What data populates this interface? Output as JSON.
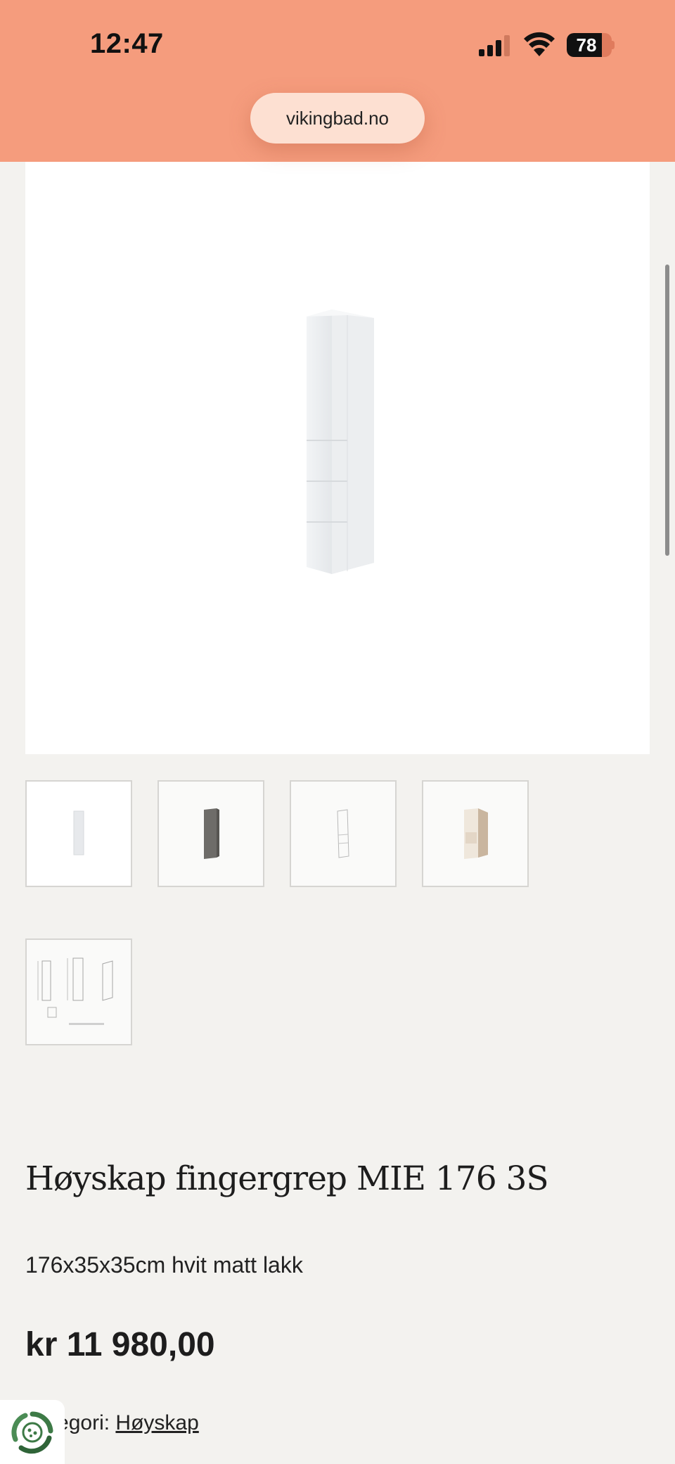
{
  "status_bar": {
    "time": "12:47",
    "battery_percent": "78",
    "battery_level": 0.78,
    "background_color": "#f59c7d"
  },
  "browser": {
    "url": "vikingbad.no"
  },
  "product": {
    "title": "Høyskap fingergrep MIE 176 3S",
    "description": "176x35x35cm hvit matt lakk",
    "price": "kr 11 980,00",
    "category_label": "Kategori:",
    "category_link": "Høyskap",
    "thumbnails": [
      {
        "name": "white-cabinet-thumbnail"
      },
      {
        "name": "grey-cabinet-thumbnail"
      },
      {
        "name": "line-drawing-thumbnail"
      },
      {
        "name": "open-cabinet-thumbnail"
      },
      {
        "name": "technical-drawing-thumbnail"
      }
    ]
  },
  "icons": {
    "signal": "signal-icon",
    "wifi": "wifi-icon",
    "cookie": "cookie-settings-icon"
  }
}
